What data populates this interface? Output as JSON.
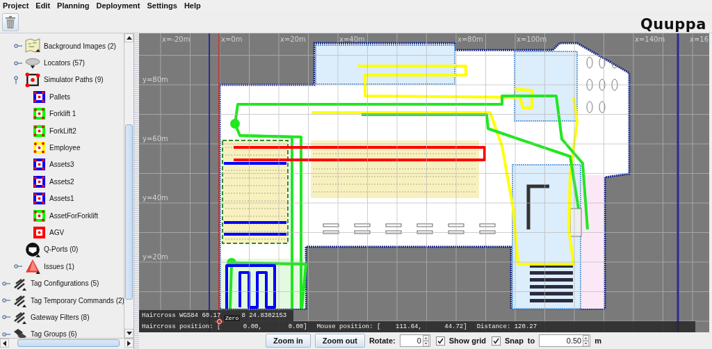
{
  "menu": [
    {
      "label": "Project"
    },
    {
      "label": "Edit"
    },
    {
      "label": "Planning"
    },
    {
      "label": "Deployment"
    },
    {
      "label": "Settings"
    },
    {
      "label": "Help"
    }
  ],
  "logo": "Quuppa",
  "tree": {
    "items": [
      {
        "children": [
          {
            "label": "Background Images (2)",
            "kind": "images",
            "expanded": false
          },
          {
            "label": "Locators (57)",
            "kind": "locators",
            "expanded": false
          },
          {
            "label": "Simulator Paths (9)",
            "kind": "paths",
            "expanded": true,
            "children": [
              {
                "label": "Pallets",
                "kind": "path",
                "color": "#0000ff"
              },
              {
                "label": "Forklift 1",
                "kind": "path",
                "color": "#00ff00"
              },
              {
                "label": "ForkLift2",
                "kind": "path",
                "color": "#00ff00"
              },
              {
                "label": "Employee",
                "kind": "path",
                "color": "#ffff00"
              },
              {
                "label": "Assets3",
                "kind": "path",
                "color": "#0000ff"
              },
              {
                "label": "Assets2",
                "kind": "path",
                "color": "#0000ff"
              },
              {
                "label": "Assets1",
                "kind": "path",
                "color": "#0000ff"
              },
              {
                "label": "AssetForForklift",
                "kind": "path",
                "color": "#00ff00"
              },
              {
                "label": "AGV",
                "kind": "path",
                "color": "#ff0000"
              }
            ]
          },
          {
            "label": "Q-Ports (0)",
            "kind": "qports"
          },
          {
            "label": "Issues (1)",
            "kind": "issues",
            "expanded": false
          }
        ]
      },
      {
        "label": "Tag Configurations (5)",
        "kind": "config",
        "expanded": false
      },
      {
        "label": "Tag Temporary Commands (2)",
        "kind": "config",
        "expanded": false
      },
      {
        "label": "Gateway Filters (8)",
        "kind": "config",
        "expanded": false
      },
      {
        "label": "Tag Groups (6)",
        "kind": "groups",
        "expanded": false
      }
    ]
  },
  "map": {
    "x_labels": [
      "x=-20m",
      "x=0m",
      "x=20m",
      "x=40m",
      "x=80m",
      "x=100m",
      "x=140m",
      "x=16"
    ],
    "y_labels": [
      "y=80m",
      "y=60m",
      "y=40m",
      "y=20m"
    ],
    "wgs84": [
      "Haircross WGS84 60.17",
      "8 24.8302153"
    ],
    "zero_label": "Zero",
    "status": [
      "Haircross position: [      0.00,       0.00]",
      "Mouse position: [    111.64,      44.72]",
      "Distance: 120.27"
    ]
  },
  "controls": {
    "zoom_in": "Zoom in",
    "zoom_out": "Zoom out",
    "rotate": {
      "label": "Rotate:",
      "value": "0"
    },
    "show_grid": {
      "label": "Show grid",
      "checked": true
    },
    "snap": {
      "label": "Snap",
      "checked": true
    },
    "snap_to": {
      "label": "to",
      "value": "0.50",
      "unit": "m"
    }
  }
}
